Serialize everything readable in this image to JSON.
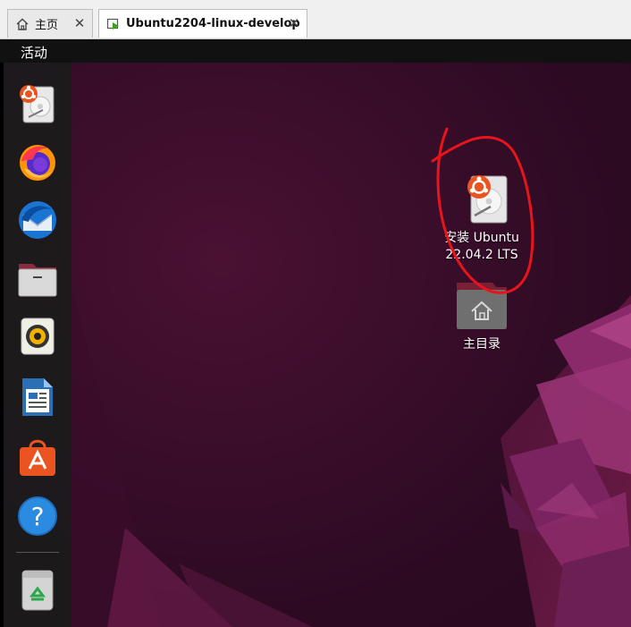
{
  "tabs": [
    {
      "label": "主页",
      "icon": "home-icon",
      "active": false
    },
    {
      "label": "Ubuntu2204-linux-develop",
      "icon": "vm-play-icon",
      "active": true
    }
  ],
  "topbar": {
    "activities_label": "活动"
  },
  "dock": {
    "items": [
      {
        "name": "install-ubuntu-dock-icon",
        "icon": "installer-disk-icon"
      },
      {
        "name": "firefox-dock-icon",
        "icon": "firefox-icon"
      },
      {
        "name": "thunderbird-dock-icon",
        "icon": "thunderbird-icon"
      },
      {
        "name": "files-dock-icon",
        "icon": "files-folder-icon"
      },
      {
        "name": "rhythmbox-dock-icon",
        "icon": "rhythmbox-speaker-icon"
      },
      {
        "name": "libreoffice-writer-dock-icon",
        "icon": "writer-document-icon"
      },
      {
        "name": "ubuntu-software-dock-icon",
        "icon": "software-bag-icon"
      },
      {
        "name": "help-dock-icon",
        "icon": "help-question-icon"
      },
      {
        "name": "trash-dock-icon",
        "icon": "trash-recycle-icon"
      }
    ]
  },
  "desktop": {
    "install_item": {
      "label_line1": "安装 Ubuntu",
      "label_line2": "22.04.2 LTS",
      "icon": "installer-disk-icon"
    },
    "home_item": {
      "label": "主目录",
      "icon": "home-folder-icon"
    }
  },
  "colors": {
    "desktop_bg": "#3d0e2c",
    "dock_bg": "#1b1b1b",
    "ubuntu_orange": "#e95420",
    "annotation_red": "#e8141c"
  }
}
